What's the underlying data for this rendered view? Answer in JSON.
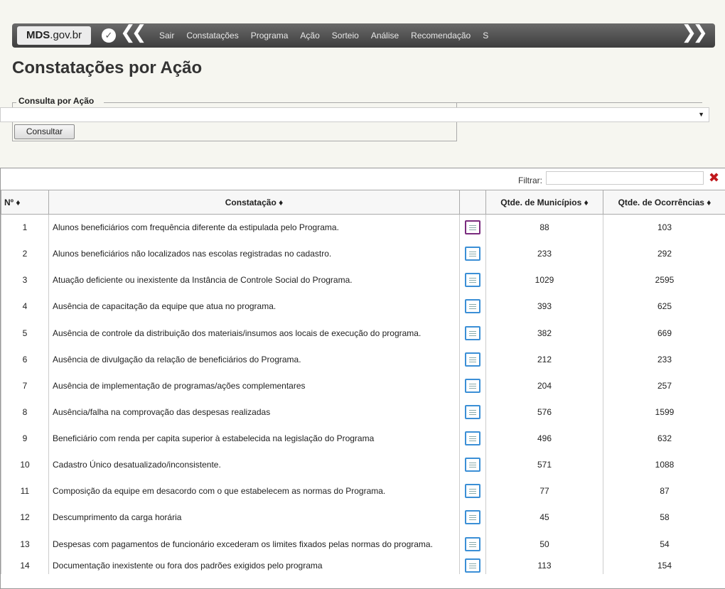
{
  "nav": {
    "brand_bold": "MDS",
    "brand_rest": ".gov.br",
    "items": [
      "Sair",
      "Constatações",
      "Programa",
      "Ação",
      "Sorteio",
      "Análise",
      "Recomendação",
      "S"
    ]
  },
  "page_title": "Constatações por Ação",
  "form": {
    "legend": "Consulta por Ação",
    "select_value": "",
    "button_label": "Consultar"
  },
  "table": {
    "filter_label": "Filtrar:",
    "filter_value": "",
    "headers": {
      "num": "Nº ♦",
      "constatacao": "Constatação ♦",
      "municipios": "Qtde. de Municípios ♦",
      "ocorrencias": "Qtde. de Ocorrências ♦"
    },
    "rows": [
      {
        "n": "1",
        "text": "Alunos beneficiários com frequência diferente da estipulada pelo Programa.",
        "mun": "88",
        "oc": "103"
      },
      {
        "n": "2",
        "text": "Alunos beneficiários não localizados nas escolas registradas no cadastro.",
        "mun": "233",
        "oc": "292"
      },
      {
        "n": "3",
        "text": "Atuação deficiente ou inexistente da Instância de Controle Social do Programa.",
        "mun": "1029",
        "oc": "2595"
      },
      {
        "n": "4",
        "text": "Ausência de capacitação da equipe que atua no programa.",
        "mun": "393",
        "oc": "625"
      },
      {
        "n": "5",
        "text": "Ausência de controle da distribuição dos materiais/insumos aos locais de execução do programa.",
        "mun": "382",
        "oc": "669"
      },
      {
        "n": "6",
        "text": "Ausência de divulgação da relação de beneficiários do Programa.",
        "mun": "212",
        "oc": "233"
      },
      {
        "n": "7",
        "text": "Ausência de implementação de programas/ações complementares",
        "mun": "204",
        "oc": "257"
      },
      {
        "n": "8",
        "text": "Ausência/falha na comprovação das despesas realizadas",
        "mun": "576",
        "oc": "1599"
      },
      {
        "n": "9",
        "text": "Beneficiário com renda per capita superior à estabelecida na legislação do Programa",
        "mun": "496",
        "oc": "632"
      },
      {
        "n": "10",
        "text": "Cadastro Único desatualizado/inconsistente.",
        "mun": "571",
        "oc": "1088"
      },
      {
        "n": "11",
        "text": "Composição da equipe em desacordo com o que estabelecem as normas do Programa.",
        "mun": "77",
        "oc": "87"
      },
      {
        "n": "12",
        "text": "Descumprimento da carga horária",
        "mun": "45",
        "oc": "58"
      },
      {
        "n": "13",
        "text": "Despesas com pagamentos de funcionário excederam os limites fixados pelas normas do programa.",
        "mun": "50",
        "oc": "54"
      },
      {
        "n": "14",
        "text": "Documentação inexistente ou fora dos padrões exigidos pelo programa",
        "mun": "113",
        "oc": "154"
      }
    ]
  },
  "icons": {
    "menu": "chevron-down-circle-icon",
    "back": "double-chevron-left-icon",
    "forward": "double-chevron-right-icon",
    "details": "document-icon",
    "clear": "close-x-icon"
  },
  "colors": {
    "navbar": "#4e4e4e",
    "clear_x": "#c0171b",
    "doc_border": "#3b8fd6",
    "doc_selected_border": "#7a2c7e"
  }
}
